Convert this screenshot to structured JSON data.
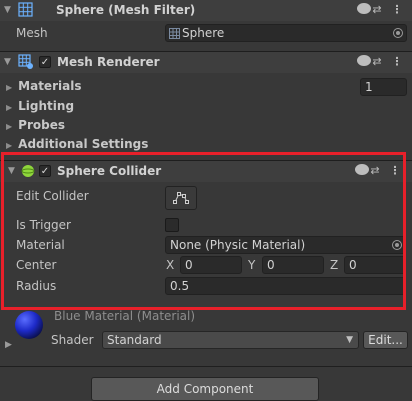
{
  "mesh_filter": {
    "title": "Sphere (Mesh Filter)",
    "mesh_label": "Mesh",
    "mesh_value": "Sphere"
  },
  "mesh_renderer": {
    "title": "Mesh Renderer",
    "enabled": true,
    "sections": [
      {
        "label": "Materials",
        "value": "1"
      },
      {
        "label": "Lighting"
      },
      {
        "label": "Probes"
      },
      {
        "label": "Additional Settings"
      }
    ]
  },
  "sphere_collider": {
    "title": "Sphere Collider",
    "enabled": true,
    "edit_collider_label": "Edit Collider",
    "is_trigger_label": "Is Trigger",
    "is_trigger": false,
    "material_label": "Material",
    "material_value": "None (Physic Material)",
    "center_label": "Center",
    "center": {
      "x_label": "X",
      "x": "0",
      "y_label": "Y",
      "y": "0",
      "z_label": "Z",
      "z": "0"
    },
    "radius_label": "Radius",
    "radius": "0.5"
  },
  "material_preview": {
    "name": "Blue Material (Material)",
    "shader_label": "Shader",
    "shader_value": "Standard",
    "edit_label": "Edit..."
  },
  "add_component_label": "Add Component",
  "colors": {
    "highlight_border": "#e8202a",
    "panel_bg": "#383838",
    "header_bg": "#3e3e3e"
  },
  "icons": {
    "help": "help-icon",
    "presets": "presets-icon",
    "context_menu": "kebab-menu-icon",
    "mesh_filter": "mesh-filter-icon",
    "mesh_renderer": "mesh-renderer-icon",
    "collider": "sphere-collider-icon"
  }
}
